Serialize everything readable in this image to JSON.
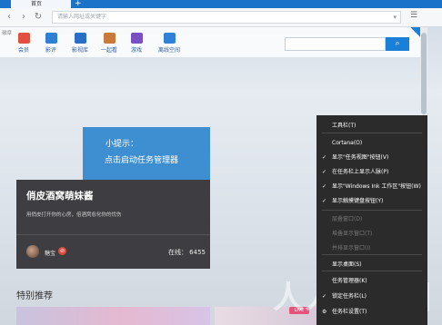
{
  "browser": {
    "tab_title": "首页",
    "tab_close": "×",
    "new_tab": "+",
    "address_placeholder": "请输入网址或关键字",
    "menu_glyph": "☰"
  },
  "page": {
    "logo_alt": "徽章",
    "nav_items": [
      {
        "label": "会员",
        "color": "#e2513f"
      },
      {
        "label": "影评",
        "color": "#2f7fd4"
      },
      {
        "label": "影视库",
        "color": "#2a6fc7"
      },
      {
        "label": "一起看",
        "color": "#c97a3b"
      },
      {
        "label": "游戏",
        "color": "#7a4fc1"
      },
      {
        "label": "离线空间",
        "color": "#2f82d8"
      }
    ],
    "search_icon": "⌕",
    "tip": {
      "title": "小提示：",
      "body": "点击启动任务管理器"
    },
    "card": {
      "title": "俏皮酒窝萌妹酱",
      "subtitle": "用俏皮打开你的心房，倍酒窝愈化你的忧伤",
      "host": "糖宝",
      "online": "在线： 6455"
    },
    "section_title": "特别推荐",
    "live_badge": "LIVE"
  },
  "context_menu": {
    "items": [
      {
        "label": "工具栏(T)",
        "checked": false,
        "disabled": false
      },
      {
        "label": "Cortana(O)",
        "checked": false,
        "disabled": false
      },
      {
        "label": "显示\"任务视图\"按钮(V)",
        "checked": true,
        "disabled": false
      },
      {
        "label": "在任务栏上显示人脉(P)",
        "checked": true,
        "disabled": false
      },
      {
        "label": "显示\"Windows Ink 工作区\"按钮(W)",
        "checked": true,
        "disabled": false
      },
      {
        "label": "显示触摸键盘按钮(Y)",
        "checked": true,
        "disabled": false
      },
      {
        "label": "层叠窗口(D)",
        "checked": false,
        "disabled": true
      },
      {
        "label": "堆叠显示窗口(T)",
        "checked": false,
        "disabled": true
      },
      {
        "label": "并排显示窗口(I)",
        "checked": false,
        "disabled": true
      },
      {
        "label": "显示桌面(S)",
        "checked": false,
        "disabled": false
      },
      {
        "label": "任务管理器(K)",
        "checked": false,
        "disabled": false
      },
      {
        "label": "锁定任务栏(L)",
        "checked": true,
        "disabled": false
      },
      {
        "label": "任务栏设置(T)",
        "checked": false,
        "disabled": false
      }
    ]
  },
  "watermark": "人人软件园"
}
